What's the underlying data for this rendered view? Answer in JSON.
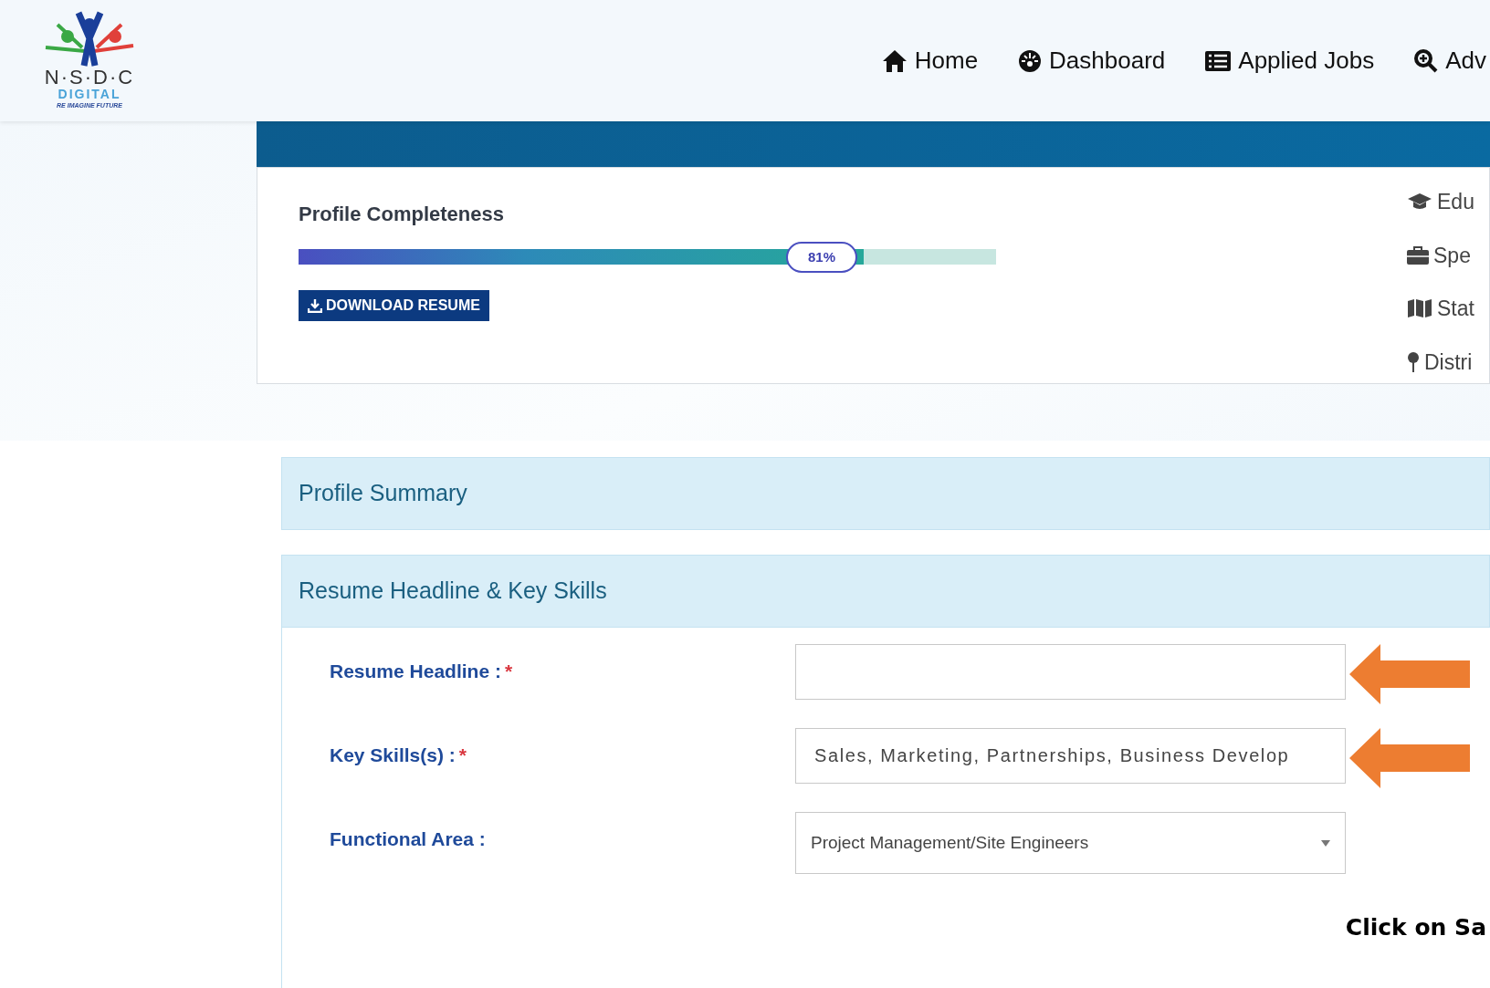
{
  "logo": {
    "name": "N·S·D·C",
    "subtitle": "DIGITAL",
    "tagline": "RE IMAGINE FUTURE"
  },
  "nav": [
    {
      "label": "Home",
      "kind": "home"
    },
    {
      "label": "Dashboard",
      "kind": "dashboard"
    },
    {
      "label": "Applied Jobs",
      "kind": "list"
    },
    {
      "label": "Adv",
      "kind": "search"
    }
  ],
  "profile": {
    "title": "Profile Completeness",
    "level": 0.81,
    "reading": "81%",
    "download_button": "DOWNLOAD RESUME",
    "details": [
      {
        "label": "Edu",
        "kind": "education"
      },
      {
        "label": "Spe",
        "kind": "briefcase"
      },
      {
        "label": "Stat",
        "kind": "map"
      },
      {
        "label": "Distri",
        "kind": "pin"
      }
    ]
  },
  "sections": [
    {
      "title": "Profile Summary"
    },
    {
      "title": "Resume Headline & Key Skills",
      "fields": [
        {
          "label": "Resume Headline :",
          "marker": "*",
          "kind": "text",
          "arrow": true
        },
        {
          "label": "Key Skills(s) :",
          "marker": "*",
          "kind": "text",
          "value": "Sales, Marketing, Partnerships, Business Develop",
          "arrow": true
        },
        {
          "label": "Functional Area :",
          "kind": "select",
          "value": "Project Management/Site Engineers",
          "arrow": false
        }
      ],
      "instruction": "Click on Sa"
    }
  ]
}
